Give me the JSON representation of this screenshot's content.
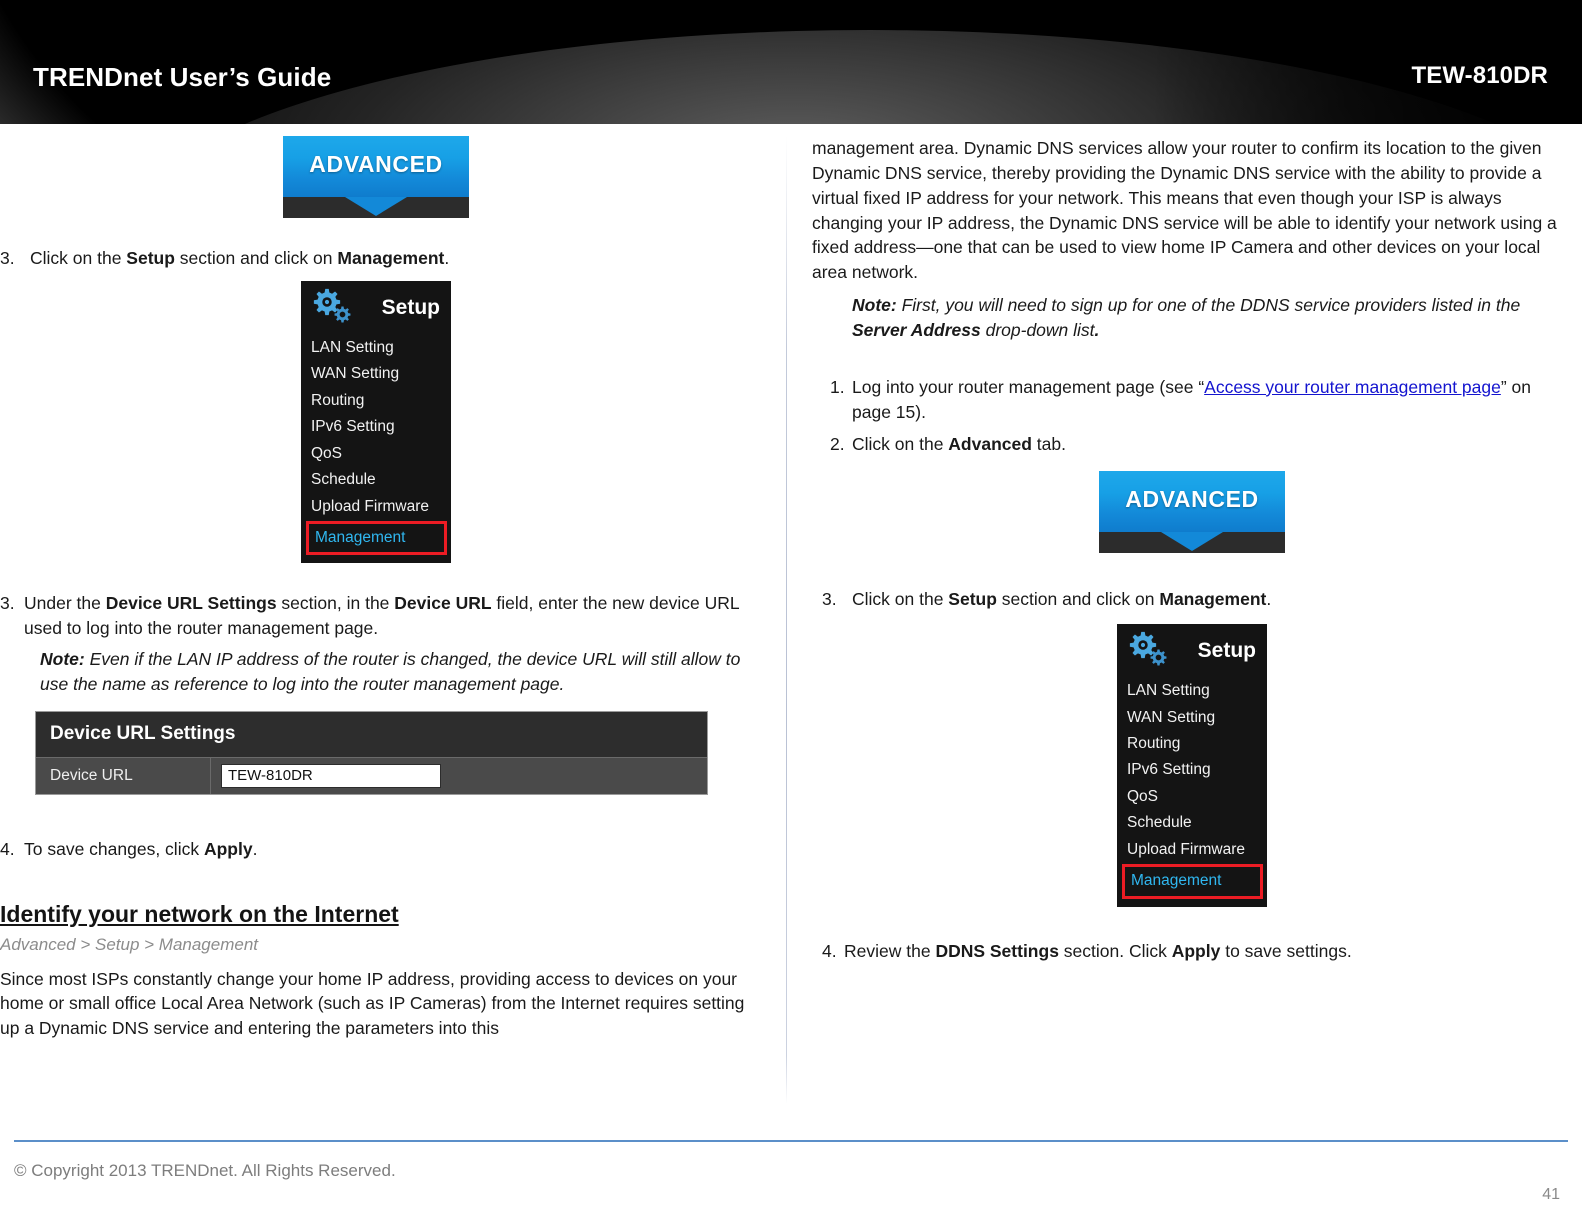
{
  "header": {
    "title": "TRENDnet User’s Guide",
    "model": "TEW-810DR"
  },
  "advanced_tab": {
    "label": "ADVANCED"
  },
  "setup_menu": {
    "title": "Setup",
    "items": [
      "LAN Setting",
      "WAN Setting",
      "Routing",
      "IPv6 Setting",
      "QoS",
      "Schedule",
      "Upload Firmware"
    ],
    "selected_item": "Management",
    "selected_color": "#30b7f0",
    "highlight_color": "#ec1c24"
  },
  "left_column": {
    "step3": {
      "num": "3.",
      "part1": "Click on the ",
      "bold1": "Setup",
      "part2": " section and click on ",
      "bold2": "Management",
      "part3": "."
    },
    "step3b": {
      "num": "3.",
      "part1": "Under the ",
      "bold1": "Device URL Settings",
      "part2": " section, in the ",
      "bold2": "Device URL",
      "part3": " field, enter the new device URL used to log into the router management page."
    },
    "note": {
      "label": "Note:",
      "text": " Even if the LAN IP address of the router is changed, the device URL will still allow to use the name as reference to log into the router management page."
    },
    "panel": {
      "title": "Device URL Settings",
      "row_label": "Device URL",
      "input_value": "TEW-810DR"
    },
    "step4": {
      "num": "4.",
      "part1": "To save changes, click ",
      "bold1": "Apply",
      "part2": "."
    },
    "section_title": "Identify your network on the Internet",
    "breadcrumb": "Advanced > Setup > Management",
    "body_paragraph": "Since most ISPs constantly change your home IP address, providing access to devices on your home or small office Local Area Network (such as IP Cameras) from the Internet requires setting up a Dynamic DNS service and entering the parameters into this"
  },
  "right_column": {
    "continued_paragraph": "management area. Dynamic DNS services allow your router to confirm its location to the given Dynamic DNS service, thereby providing the Dynamic DNS service with the ability to provide a virtual fixed IP address for your network. This means that even though your ISP is always changing your IP address, the Dynamic DNS service will be able to identify your network using a fixed address—one that can be used to view home IP Camera and other devices on your local area network.",
    "note": {
      "label": "Note:",
      "part1": " First, you will need to sign up for one of the DDNS service providers listed in the ",
      "bold1": "Server Address",
      "part2": " drop-down list",
      "part3": "."
    },
    "step1": {
      "num": "1.",
      "part1": "Log into your router management page (see “",
      "link": "Access your router management page",
      "part2": "” on page 15)."
    },
    "step2": {
      "num": "2.",
      "part1": "Click on the ",
      "bold1": "Advanced",
      "part2": " tab."
    },
    "step3": {
      "num": "3.",
      "part1": "Click on the ",
      "bold1": "Setup",
      "part2": " section and click on ",
      "bold2": "Management",
      "part3": "."
    },
    "step4": {
      "num": "4.",
      "part1": "Review the ",
      "bold1": "DDNS Settings",
      "part2": " section. Click ",
      "bold2": "Apply",
      "part3": " to save settings."
    }
  },
  "footer": {
    "copyright": "© Copyright 2013 TRENDnet. All Rights Reserved.",
    "page_number": "41",
    "rule_color": "#5b8fc9"
  }
}
